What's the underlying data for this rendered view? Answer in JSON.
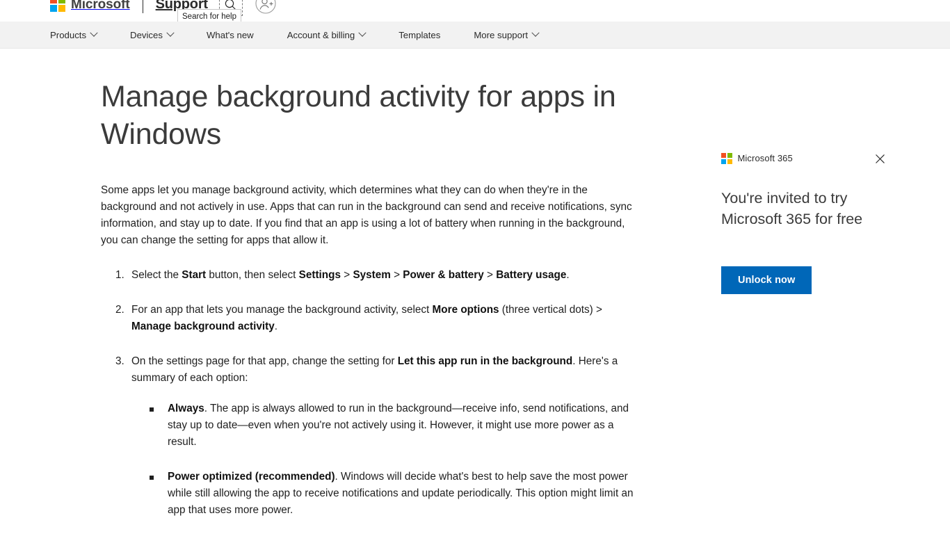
{
  "header": {
    "brand": "Microsoft",
    "section": "Support",
    "search_icon": "magnifier-icon",
    "account_icon": "account-add-person-icon",
    "tooltip": "Search for help"
  },
  "nav": {
    "items": [
      {
        "label": "Products",
        "has_chevron": true
      },
      {
        "label": "Devices",
        "has_chevron": true
      },
      {
        "label": "What's new",
        "has_chevron": false
      },
      {
        "label": "Account & billing",
        "has_chevron": true
      },
      {
        "label": "Templates",
        "has_chevron": false
      },
      {
        "label": "More support",
        "has_chevron": true
      }
    ]
  },
  "article": {
    "title": "Manage background activity for apps in Windows",
    "intro": "Some apps let you manage background activity, which determines what they can do when they're in the background and not actively in use. Apps that can run in the background can send and receive notifications, sync information, and stay up to date. If you find that an app is using a lot of battery when running in the background, you can change the setting for apps that allow it.",
    "steps": [
      {
        "parts": [
          {
            "text": "Select the ",
            "bold": false
          },
          {
            "text": "Start",
            "bold": true
          },
          {
            "text": " button, then select ",
            "bold": false
          },
          {
            "text": "Settings",
            "bold": true
          },
          {
            "text": " > ",
            "bold": false
          },
          {
            "text": "System",
            "bold": true
          },
          {
            "text": " > ",
            "bold": false
          },
          {
            "text": "Power & battery",
            "bold": true
          },
          {
            "text": " > ",
            "bold": false
          },
          {
            "text": "Battery usage",
            "bold": true
          },
          {
            "text": ".",
            "bold": false
          }
        ]
      },
      {
        "parts": [
          {
            "text": "For an app that lets you manage the background activity, select ",
            "bold": false
          },
          {
            "text": "More options",
            "bold": true
          },
          {
            "text": " (three vertical dots) > ",
            "bold": false
          },
          {
            "text": "Manage background activity",
            "bold": true
          },
          {
            "text": ".",
            "bold": false
          }
        ]
      },
      {
        "parts": [
          {
            "text": "On the settings page for that app, change the setting for ",
            "bold": false
          },
          {
            "text": "Let this app run in the background",
            "bold": true
          },
          {
            "text": ". Here's a summary of each option:",
            "bold": false
          }
        ]
      }
    ],
    "options": [
      {
        "parts": [
          {
            "text": "Always",
            "bold": true
          },
          {
            "text": ". The app is always allowed to run in the background—receive info, send notifications, and stay up to date—even when you're not actively using it. However, it might use more power as a result.",
            "bold": false
          }
        ]
      },
      {
        "parts": [
          {
            "text": "Power optimized (recommended)",
            "bold": true
          },
          {
            "text": ". Windows will decide what's best to help save the most power while still allowing the app to receive notifications and update periodically. This option might limit an app that uses more power.",
            "bold": false
          }
        ]
      }
    ]
  },
  "promo": {
    "brand": "Microsoft 365",
    "headline": "You're invited to try Microsoft 365 for free",
    "cta_label": "Unlock now",
    "close_icon": "close-x-icon",
    "accent_color": "#0067b8"
  },
  "colors": {
    "ms_red": "#f25022",
    "ms_green": "#7fba00",
    "ms_blue": "#00a4ef",
    "ms_yellow": "#ffb900",
    "nav_background": "#f2f2f2",
    "page_background": "#ffffff",
    "body_text": "#1f1f1f",
    "heading_text": "#3b3b3b"
  }
}
